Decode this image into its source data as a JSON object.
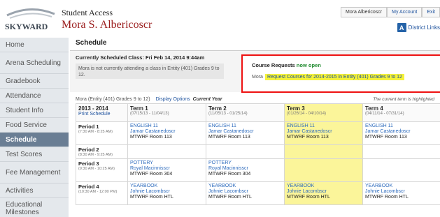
{
  "header": {
    "app_title": "Student Access",
    "user_name": "Mora S. Albericoscr",
    "logo_text": "SKYWARD",
    "links": {
      "student": "Mora Albericoscr",
      "account": "My Account",
      "exit": "Exit"
    },
    "district_links": "District Links"
  },
  "sidebar": {
    "items": [
      "Home",
      "Arena Scheduling",
      "Gradebook",
      "Attendance",
      "Student Info",
      "Food Service",
      "Schedule",
      "Test Scores",
      "Fee Management",
      "Activities",
      "Educational Milestones"
    ]
  },
  "main": {
    "title": "Schedule",
    "currently_scheduled": "Currently Scheduled Class: Fri Feb 14, 2014 9:44am",
    "not_attending": "Mora is not currently attending a class in Entity (401) Grades 9 to 12.",
    "course_requests": {
      "title": "Course Requests",
      "status": "now open",
      "student": "Mora",
      "link": "Request Courses for 2014-2015 in Entity (401) Grades 9 to 12"
    },
    "options": {
      "entity": "Mora  (Entity (401) Grades 9 to 12)",
      "display_options": "Display Options",
      "current_year": "Current Year",
      "note": "The current term is highlighted"
    }
  },
  "schedule": {
    "header": {
      "year": "2013 - 2014",
      "print": "Print Schedule",
      "terms": [
        {
          "name": "Term 1",
          "dates": "(07/15/13 - 11/04/13)"
        },
        {
          "name": "Term 2",
          "dates": "(11/05/13 - 01/25/14)"
        },
        {
          "name": "Term 3",
          "dates": "(01/26/14 - 04/10/14)"
        },
        {
          "name": "Term 4",
          "dates": "(04/11/14 - 07/31/14)"
        }
      ]
    },
    "periods": [
      {
        "name": "Period 1",
        "time": "(7:30 AM - 8:25 AM)",
        "cells": [
          {
            "course": "ENGLISH 11",
            "teacher": "Jamar Castanedoscr",
            "loc": "MTWRF  Room 113"
          },
          {
            "course": "ENGLISH 11",
            "teacher": "Jamar Castanedoscr",
            "loc": "MTWRF  Room 113"
          },
          {
            "course": "ENGLISH 11",
            "teacher": "Jamar Castanedoscr",
            "loc": "MTWRF  Room 113"
          },
          {
            "course": "ENGLISH 11",
            "teacher": "Jamar Castanedoscr",
            "loc": "MTWRF  Room 113"
          }
        ]
      },
      {
        "name": "Period 2",
        "time": "(8:30 AM - 9:25 AM)",
        "cells": [
          {
            "course": "",
            "teacher": "",
            "loc": ""
          },
          {
            "course": "",
            "teacher": "",
            "loc": ""
          },
          {
            "course": "",
            "teacher": "",
            "loc": ""
          },
          {
            "course": "",
            "teacher": "",
            "loc": ""
          }
        ]
      },
      {
        "name": "Period 3",
        "time": "(9:30 AM - 10:25 AM)",
        "cells": [
          {
            "course": "POTTERY",
            "teacher": "Royal Macinnisscr",
            "loc": "MTWRF  Room 304"
          },
          {
            "course": "POTTERY",
            "teacher": "Royal Macinnisscr",
            "loc": "MTWRF  Room 304"
          },
          {
            "course": "",
            "teacher": "",
            "loc": ""
          },
          {
            "course": "",
            "teacher": "",
            "loc": ""
          }
        ]
      },
      {
        "name": "Period 4",
        "time": "(10:30 AM - 12:00 PM)",
        "cells": [
          {
            "course": "YEARBOOK",
            "teacher": "Johnie Lacombscr",
            "loc": "MTWRF  Room HTL"
          },
          {
            "course": "YEARBOOK",
            "teacher": "Johnie Lacombscr",
            "loc": "MTWRF  Room HTL"
          },
          {
            "course": "YEARBOOK",
            "teacher": "Johnie Lacombscr",
            "loc": "MTWRF  Room HTL"
          },
          {
            "course": "YEARBOOK",
            "teacher": "Johnie Lacombscr",
            "loc": "MTWRF  Room HTL"
          }
        ]
      }
    ]
  },
  "colors": {
    "accent": "#1a4f9c",
    "highlight": "#fbf59a",
    "alert_border": "#ee1111",
    "active_nav": "#6a7e94"
  }
}
